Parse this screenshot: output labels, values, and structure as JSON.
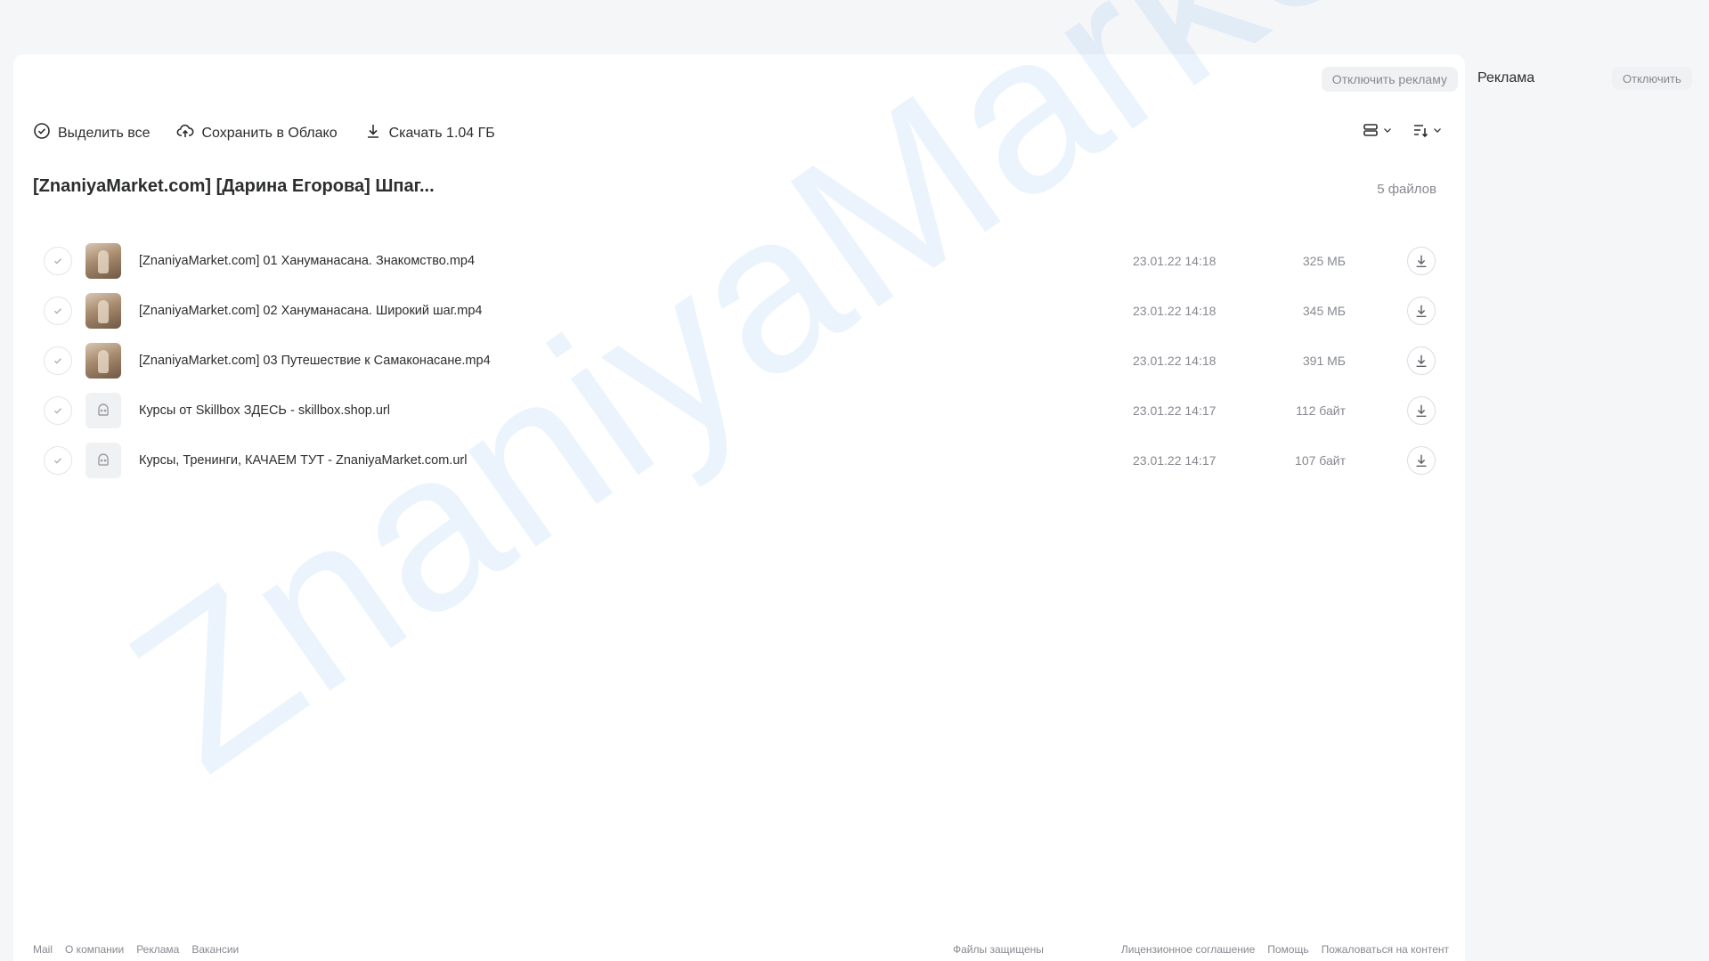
{
  "top_actions": {
    "disable_ads_label": "Отключить рекламу"
  },
  "toolbar": {
    "select_all_label": "Выделить все",
    "save_to_cloud_label": "Сохранить в Облако",
    "download_label": "Скачать 1.04 ГБ"
  },
  "folder": {
    "title": "[ZnaniyaMarket.com] [Дарина Егорова] Шпаг...",
    "file_count": "5 файлов"
  },
  "files": [
    {
      "name": "[ZnaniyaMarket.com] 01 Хануманасана. Знакомство.mp4",
      "date": "23.01.22 14:18",
      "size": "325 МБ",
      "type": "video"
    },
    {
      "name": "[ZnaniyaMarket.com] 02 Хануманасана. Широкий шаг.mp4",
      "date": "23.01.22 14:18",
      "size": "345 МБ",
      "type": "video"
    },
    {
      "name": "[ZnaniyaMarket.com] 03 Путешествие к Самаконасане.mp4",
      "date": "23.01.22 14:18",
      "size": "391 МБ",
      "type": "video"
    },
    {
      "name": "Курсы от Skillbox ЗДЕСЬ - skillbox.shop.url",
      "date": "23.01.22 14:17",
      "size": "112 байт",
      "type": "link"
    },
    {
      "name": "Курсы, Тренинги, КАЧАЕМ ТУТ - ZnaniyaMarket.com.url",
      "date": "23.01.22 14:17",
      "size": "107 байт",
      "type": "link"
    }
  ],
  "footer": {
    "left_links": [
      "Mail",
      "О компании",
      "Реклама",
      "Вакансии"
    ],
    "middle_text": "Файлы защищены",
    "right_links": [
      "Лицензионное соглашение",
      "Помощь",
      "Пожаловаться на контент"
    ]
  },
  "sidebar": {
    "title": "Реклама",
    "disable_label": "Отключить"
  },
  "watermark": "ZnaniyaMarket.club",
  "colors": {
    "background": "#f5f6f8",
    "panel": "#ffffff",
    "text": "#2c2d2e",
    "muted": "#87898f",
    "watermark": "#3c96f0"
  }
}
